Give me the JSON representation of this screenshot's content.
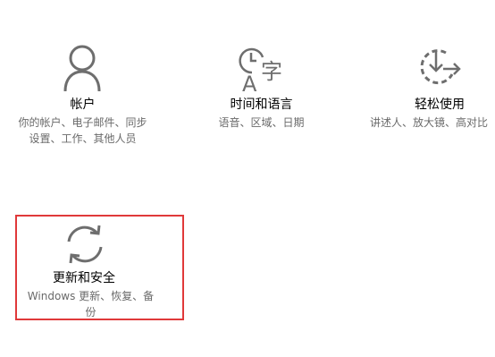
{
  "tiles": {
    "accounts": {
      "title": "帐户",
      "desc_line1": "你的帐户、电子邮件、同步",
      "desc_line2": "设置、工作、其他人员",
      "icon": "person-icon"
    },
    "time_language": {
      "title": "时间和语言",
      "desc_line1": "语音、区域、日期",
      "icon": "time-language-icon"
    },
    "ease_of_access": {
      "title": "轻松使用",
      "desc_line1": "讲述人、放大镜、高对比",
      "icon": "ease-of-access-icon"
    },
    "update_security": {
      "title": "更新和安全",
      "desc_line1": "Windows 更新、恢复、备",
      "desc_line2": "份",
      "icon": "sync-arrows-icon",
      "highlight_color": "#e0393a"
    }
  },
  "colors": {
    "icon": "#6e6e6e",
    "desc_text": "#6a6a6a",
    "title_text": "#000000"
  }
}
